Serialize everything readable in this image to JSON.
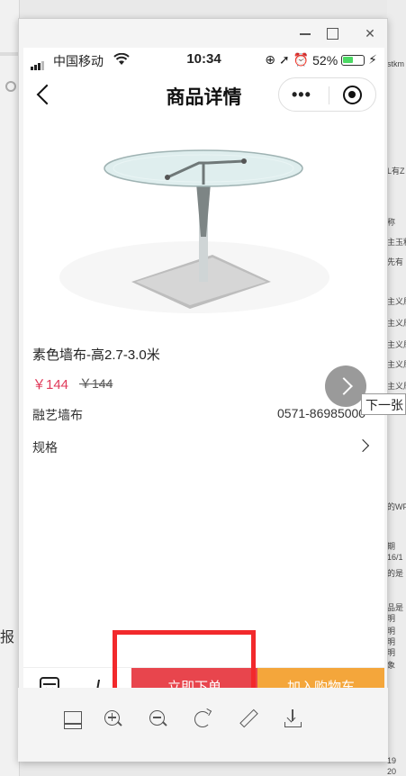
{
  "status_bar": {
    "carrier": "中国移动",
    "time": "10:34",
    "battery_percent": "52%",
    "battery_level": 0.52
  },
  "navbar": {
    "title": "商品详情"
  },
  "product": {
    "name": "素色墙布-高2.7-3.0米",
    "price": "￥144",
    "original_price": "￥144",
    "brand": "融艺墙布",
    "phone": "0571-86985000",
    "spec_label": "规格"
  },
  "tooltip": "下一张",
  "actions": {
    "buy_now": "立即下单",
    "add_to_cart": "加入购物车"
  },
  "background": {
    "left_text": "报",
    "right_strip_texts": [
      "stkm",
      "L有Z",
      "称",
      "主玉料",
      "先有",
      "主义局",
      "主义局",
      "主义局",
      "主义局",
      "主义局",
      "的WP",
      "期",
      "16/1",
      "的是",
      "品是",
      "明",
      "明",
      "明",
      "明",
      "象",
      "19",
      "20"
    ]
  },
  "colors": {
    "price": "#e03a5a",
    "buy_button": "#e8454d",
    "cart_button": "#f4a63b",
    "highlight": "#f2292c"
  }
}
